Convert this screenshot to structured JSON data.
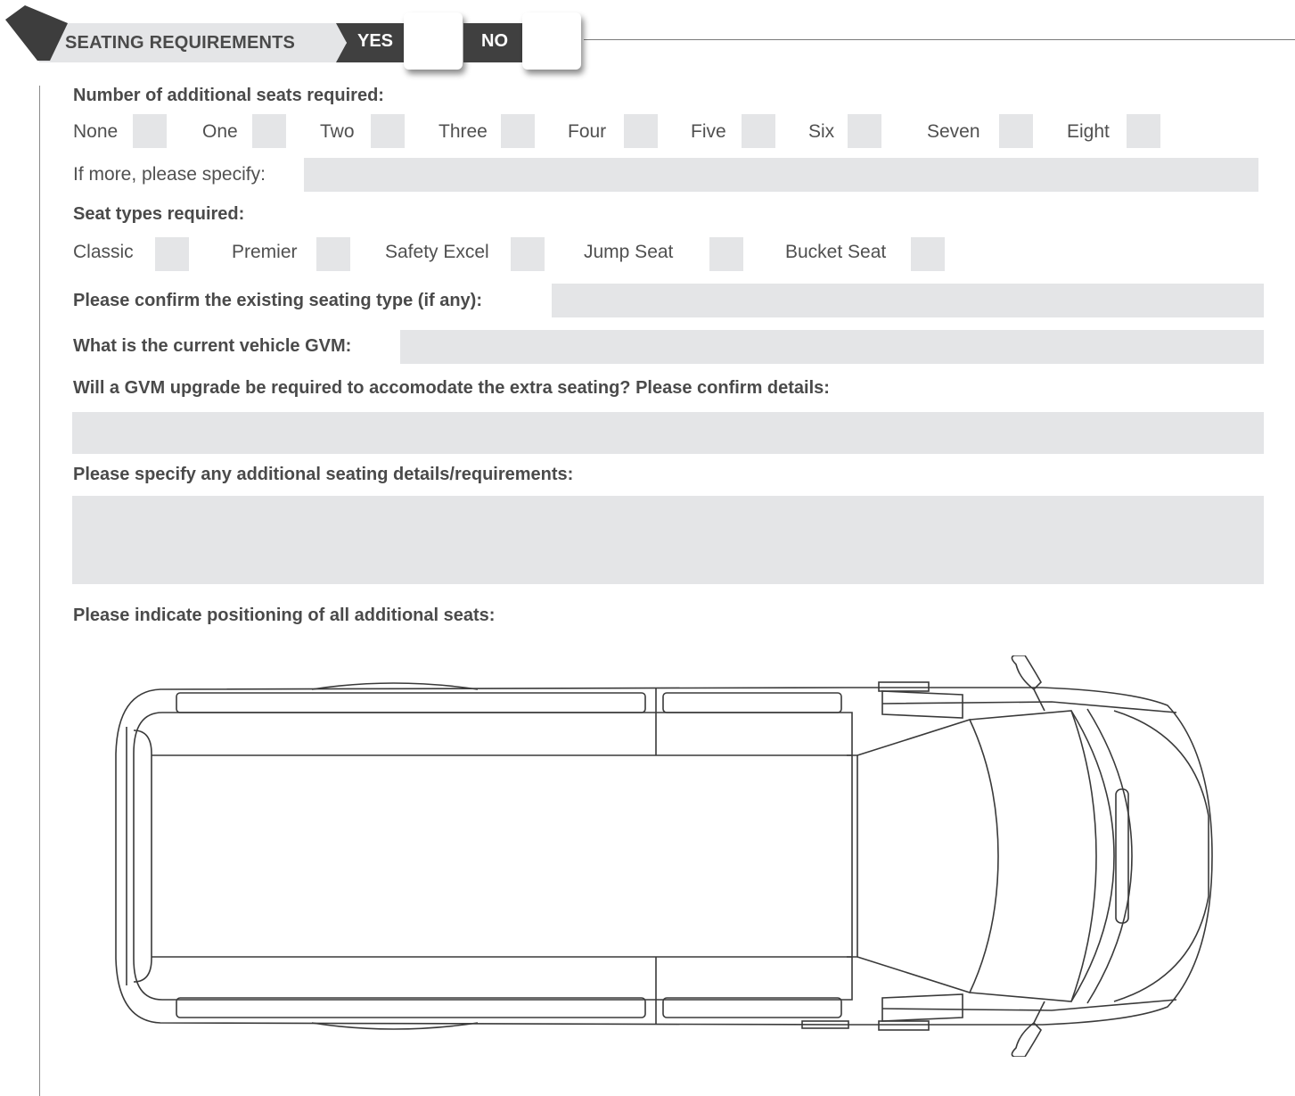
{
  "header": {
    "title": "SEATING REQUIREMENTS",
    "yes_label": "YES",
    "no_label": "NO"
  },
  "seats": {
    "question": "Number of additional seats required:",
    "options": [
      "None",
      "One",
      "Two",
      "Three",
      "Four",
      "Five",
      "Six",
      "Seven",
      "Eight"
    ],
    "more_label": "If more, please specify:"
  },
  "seat_types": {
    "question": "Seat types required:",
    "options": [
      "Classic",
      "Premier",
      "Safety Excel",
      "Jump Seat",
      "Bucket Seat"
    ]
  },
  "existing_type_label": "Please confirm the existing seating type (if any):",
  "gvm_label": "What is the current vehicle GVM:",
  "gvm_upgrade_label": "Will a GVM upgrade be required to accomodate the extra seating? Please confirm details:",
  "additional_details_label": "Please specify any additional seating details/requirements:",
  "positioning_label": "Please indicate positioning of all additional seats:",
  "colors": {
    "field_grey": "#e4e5e7",
    "tag_dark": "#404040",
    "text": "#4a4a4a"
  }
}
